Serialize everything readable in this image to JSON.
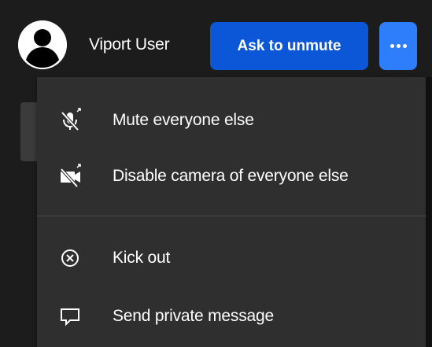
{
  "header": {
    "user_name": "Viport User",
    "ask_unmute_label": "Ask to unmute",
    "more_icon": "more-horizontal-icon",
    "accent_color": "#0b57d8"
  },
  "menu": {
    "items": [
      {
        "label": "Mute everyone else",
        "icon": "mic-off-icon"
      },
      {
        "label": "Disable camera of everyone else",
        "icon": "camera-off-icon"
      },
      {
        "label": "Kick out",
        "icon": "circle-x-icon"
      },
      {
        "label": "Send private message",
        "icon": "chat-bubble-icon"
      }
    ]
  }
}
